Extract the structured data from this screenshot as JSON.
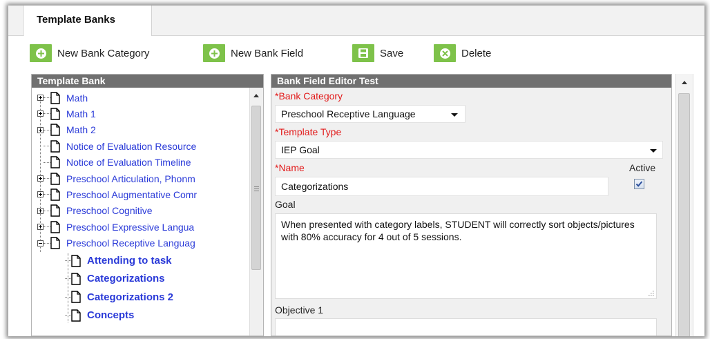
{
  "tab": {
    "label": "Template Banks"
  },
  "toolbar": {
    "new_category": "New Bank Category",
    "new_field": "New Bank Field",
    "save": "Save",
    "delete": "Delete",
    "accent": "#7ec24a"
  },
  "left_panel": {
    "header": "Template Bank",
    "items": [
      {
        "label": "Math",
        "expandable": true
      },
      {
        "label": "Math 1",
        "expandable": true
      },
      {
        "label": "Math 2",
        "expandable": true
      },
      {
        "label": "Notice of Evaluation Resource",
        "expandable": false
      },
      {
        "label": "Notice of Evaluation Timeline",
        "expandable": false
      },
      {
        "label": "Preschool Articulation, Phonm",
        "expandable": true
      },
      {
        "label": "Preschool Augmentative Comr",
        "expandable": true
      },
      {
        "label": "Preschool Cognitive",
        "expandable": true
      },
      {
        "label": "Preschool Expressive Langua",
        "expandable": true
      },
      {
        "label": "Preschool Receptive Languag",
        "expandable": true,
        "expanded": true
      }
    ],
    "children": [
      {
        "label": "Attending to task"
      },
      {
        "label": "Categorizations"
      },
      {
        "label": "Categorizations 2"
      },
      {
        "label": "Concepts"
      }
    ]
  },
  "editor": {
    "header": "Bank Field Editor Test",
    "bank_category_label": "*Bank Category",
    "bank_category_value": "Preschool Receptive Language",
    "template_type_label": "*Template Type",
    "template_type_value": "IEP Goal",
    "name_label": "*Name",
    "name_value": "Categorizations",
    "active_label": "Active",
    "active_checked": true,
    "goal_label": "Goal",
    "goal_text": "When presented with category labels, STUDENT will correctly sort objects/pictures with 80% accuracy for 4 out of 5 sessions.",
    "objective1_label": "Objective 1",
    "objective1_value": ""
  }
}
